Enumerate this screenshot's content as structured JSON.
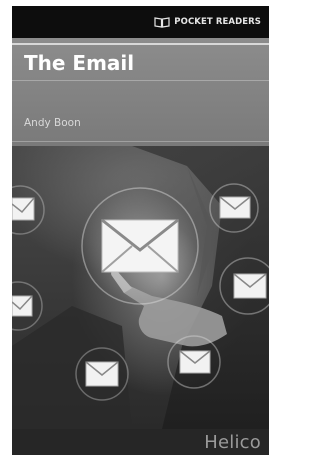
{
  "cover": {
    "series": "POCKET READERS",
    "title": "The Email",
    "author": "Andy Boon",
    "publisher": "Helico"
  },
  "icons": {
    "series_logo": "open-book-icon",
    "envelopes": "envelope-icon"
  },
  "colors": {
    "title_band": "#858585",
    "top_strip": "#0d0d0d",
    "bottom_strip": "#262626",
    "title_text": "#ffffff"
  }
}
